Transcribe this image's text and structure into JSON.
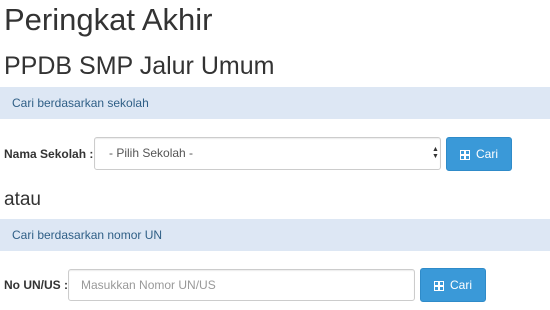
{
  "header": {
    "title": "Peringkat Akhir",
    "subtitle": "PPDB SMP Jalur Umum"
  },
  "school_search": {
    "section_label": "Cari berdasarkan sekolah",
    "field_label": "Nama Sekolah :",
    "select_value": "- Pilih Sekolah -",
    "button_label": "Cari",
    "button_icon": "grid-icon"
  },
  "separator": {
    "text": "atau"
  },
  "un_search": {
    "section_label": "Cari berdasarkan nomor UN",
    "field_label": "No UN/US :",
    "input_placeholder": "Masukkan Nomor UN/US",
    "input_value": "",
    "button_label": "Cari",
    "button_icon": "grid-icon"
  },
  "colors": {
    "section_bar_bg": "#dde7f4",
    "section_bar_text": "#2f5f86",
    "button_bg": "#3a99d8"
  }
}
